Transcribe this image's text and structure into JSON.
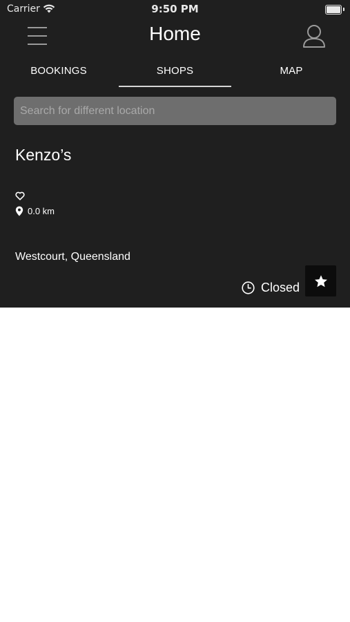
{
  "status_bar": {
    "carrier": "Carrier",
    "time": "9:50 PM",
    "wifi_icon": "wifi-icon",
    "battery_icon": "battery-icon",
    "battery_level": 1.0
  },
  "nav": {
    "title": "Home",
    "menu_icon": "hamburger-menu-icon",
    "profile_icon": "user-profile-icon"
  },
  "tabs": [
    {
      "label": "BOOKINGS",
      "selected": false
    },
    {
      "label": "SHOPS",
      "selected": true
    },
    {
      "label": "MAP",
      "selected": false
    }
  ],
  "search": {
    "placeholder": "Search for different location",
    "value": ""
  },
  "shop": {
    "name": "Kenzo’s",
    "favorite_icon": "heart-outline-icon",
    "pin_icon": "location-pin-icon",
    "distance": "0.0 km",
    "address": "Westcourt, Queensland",
    "clock_icon": "clock-icon",
    "status": "Closed",
    "star_icon": "star-icon"
  },
  "colors": {
    "panel_background": "#1f1f1f",
    "search_background": "#6e6e6e",
    "star_button_background": "#0c0c0c",
    "text": "#ffffff",
    "page_background": "#ffffff"
  }
}
